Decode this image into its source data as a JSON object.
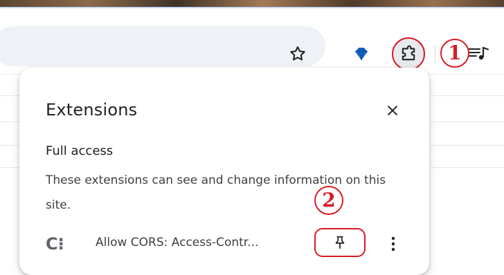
{
  "callouts": {
    "first": "1",
    "second": "2"
  },
  "extensions_panel": {
    "title": "Extensions",
    "section_heading": "Full access",
    "section_description": "These extensions can see and change information on this site.",
    "items": [
      {
        "icon_text": "C⁝",
        "name": "Allow CORS: Access-Contr..."
      }
    ]
  },
  "icons": {
    "star": "star-icon",
    "gem": "gem-icon",
    "extensions": "puzzle-piece-icon",
    "close": "close-icon",
    "pin": "pin-icon",
    "more": "more-vertical-icon",
    "media": "media-controls-icon"
  },
  "colors": {
    "accent_red": "#d81b24",
    "panel_bg": "#ffffff",
    "omnibox_bg": "#eef1f5",
    "gem_blue": "#1565c0"
  }
}
